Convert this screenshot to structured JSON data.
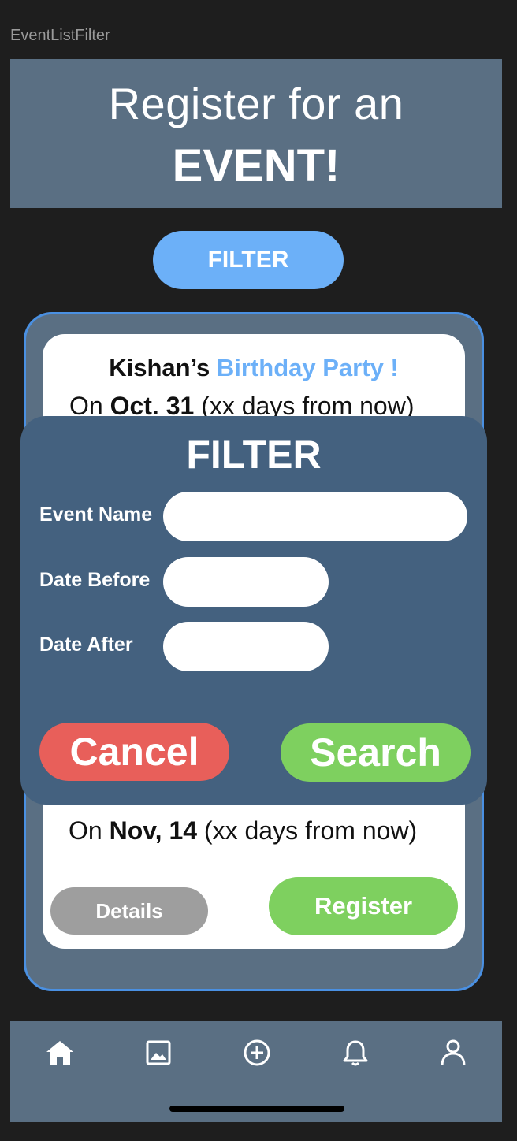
{
  "frame": {
    "label": "EventListFilter"
  },
  "header": {
    "line1": "Register for an",
    "line2": "EVENT!"
  },
  "filter_button": {
    "label": "FILTER"
  },
  "event_card": {
    "title_prefix": "Kishan’s ",
    "title_accent": "Birthday Party !",
    "date_prefix": "On ",
    "date": "Oct. 31",
    "date_suffix": " (xx days from now)"
  },
  "event_card_2": {
    "date_prefix": "On ",
    "date": "Nov, 14",
    "date_suffix": " (xx days from now)",
    "details_label": "Details",
    "register_label": "Register"
  },
  "filter_modal": {
    "title": "FILTER",
    "fields": [
      {
        "label": "Event Name",
        "value": ""
      },
      {
        "label": "Date Before",
        "value": ""
      },
      {
        "label": "Date After",
        "value": ""
      }
    ],
    "cancel_label": "Cancel",
    "search_label": "Search"
  },
  "bottom_nav": {
    "items": [
      {
        "icon": "home-icon"
      },
      {
        "icon": "image-icon"
      },
      {
        "icon": "add-circle-icon"
      },
      {
        "icon": "bell-icon"
      },
      {
        "icon": "user-icon"
      }
    ]
  },
  "colors": {
    "background": "#1e1e1e",
    "panel": "#5a6f83",
    "modal": "#44617f",
    "accent_blue": "#6cb0f8",
    "green": "#7ed05f",
    "red": "#e85f5a",
    "gray": "#9e9e9e"
  }
}
